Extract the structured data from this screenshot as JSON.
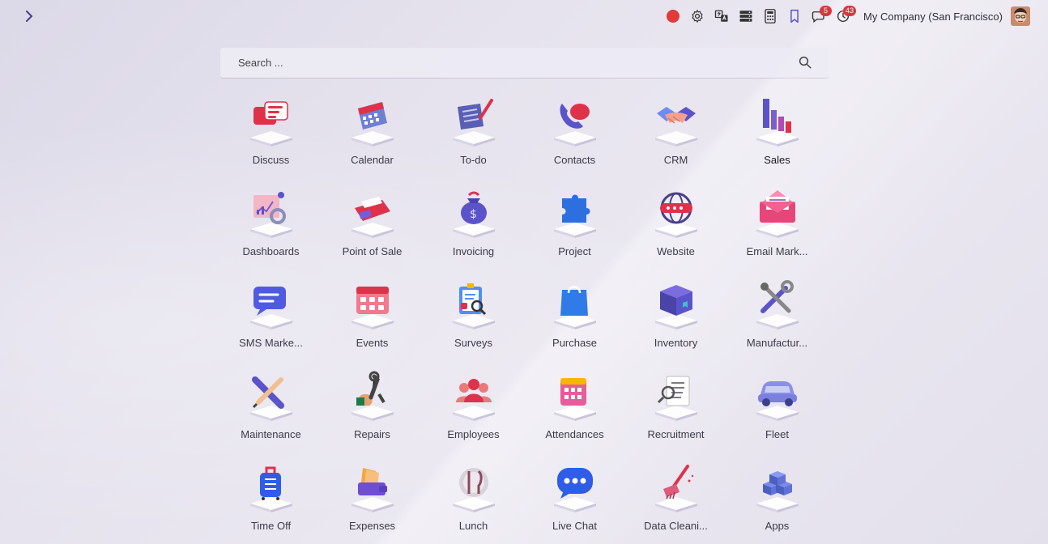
{
  "topbar": {
    "company": "My Company (San Francisco)",
    "messages_badge": "5",
    "activities_badge": "43",
    "icons": [
      "record-icon",
      "settings-icon",
      "translate-icon",
      "server-icon",
      "calculator-icon",
      "bookmark-icon",
      "chat-icon",
      "clock-icon"
    ]
  },
  "search": {
    "placeholder": "Search ..."
  },
  "apps": [
    {
      "label": "Discuss",
      "icon": "discuss-icon"
    },
    {
      "label": "Calendar",
      "icon": "calendar-icon"
    },
    {
      "label": "To-do",
      "icon": "todo-icon"
    },
    {
      "label": "Contacts",
      "icon": "contacts-icon"
    },
    {
      "label": "CRM",
      "icon": "crm-icon"
    },
    {
      "label": "Sales",
      "icon": "sales-icon"
    },
    {
      "label": "Dashboards",
      "icon": "dashboards-icon"
    },
    {
      "label": "Point of Sale",
      "icon": "point-of-sale-icon"
    },
    {
      "label": "Invoicing",
      "icon": "invoicing-icon"
    },
    {
      "label": "Project",
      "icon": "project-icon"
    },
    {
      "label": "Website",
      "icon": "website-icon"
    },
    {
      "label": "Email Mark...",
      "icon": "email-marketing-icon"
    },
    {
      "label": "SMS Marke...",
      "icon": "sms-marketing-icon"
    },
    {
      "label": "Events",
      "icon": "events-icon"
    },
    {
      "label": "Surveys",
      "icon": "surveys-icon"
    },
    {
      "label": "Purchase",
      "icon": "purchase-icon"
    },
    {
      "label": "Inventory",
      "icon": "inventory-icon"
    },
    {
      "label": "Manufactur...",
      "icon": "manufacturing-icon"
    },
    {
      "label": "Maintenance",
      "icon": "maintenance-icon"
    },
    {
      "label": "Repairs",
      "icon": "repairs-icon"
    },
    {
      "label": "Employees",
      "icon": "employees-icon"
    },
    {
      "label": "Attendances",
      "icon": "attendances-icon"
    },
    {
      "label": "Recruitment",
      "icon": "recruitment-icon"
    },
    {
      "label": "Fleet",
      "icon": "fleet-icon"
    },
    {
      "label": "Time Off",
      "icon": "time-off-icon"
    },
    {
      "label": "Expenses",
      "icon": "expenses-icon"
    },
    {
      "label": "Lunch",
      "icon": "lunch-icon"
    },
    {
      "label": "Live Chat",
      "icon": "live-chat-icon"
    },
    {
      "label": "Data Cleani...",
      "icon": "data-cleaning-icon"
    },
    {
      "label": "Apps",
      "icon": "apps-icon"
    }
  ],
  "colors": {
    "accent": "#5b53c9",
    "badge": "#d9363e",
    "record": "#e03a3a"
  }
}
